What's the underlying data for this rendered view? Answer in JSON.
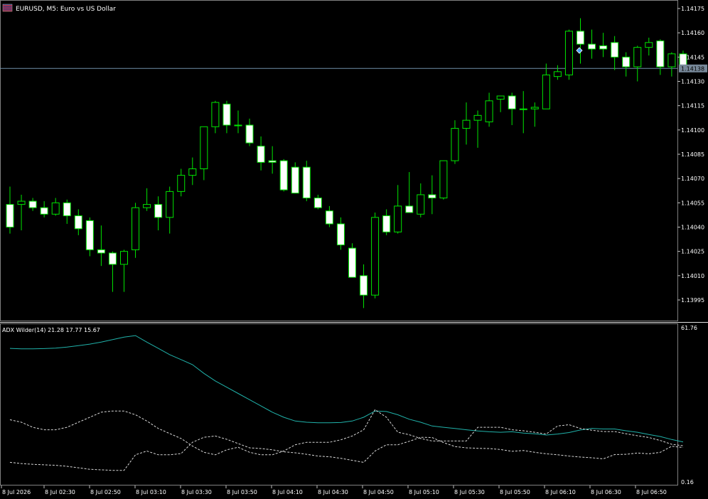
{
  "chart_data": [
    {
      "type": "candlestick",
      "title": "EURUSD, M5:  Euro vs US Dollar",
      "symbol_flag_icon": "flag-icon",
      "current_price": 1.14138,
      "current_price_label": "1.14138",
      "ylim": [
        1.1398,
        1.14183
      ],
      "y_ticks": [
        "1.14175",
        "1.14160",
        "1.14145",
        "1.14130",
        "1.14115",
        "1.14100",
        "1.14085",
        "1.14070",
        "1.14055",
        "1.14040",
        "1.14025",
        "1.14010",
        "1.13995"
      ],
      "x_ticks": [
        "8 Jul 2026",
        "8 Jul 02:30",
        "8 Jul 02:50",
        "8 Jul 03:10",
        "8 Jul 03:30",
        "8 Jul 03:50",
        "8 Jul 04:10",
        "8 Jul 04:30",
        "8 Jul 04:50",
        "8 Jul 05:10",
        "8 Jul 05:30",
        "8 Jul 05:50",
        "8 Jul 06:10",
        "8 Jul 06:30",
        "8 Jul 06:50"
      ],
      "candles": [
        {
          "o": 1.14054,
          "h": 1.14065,
          "l": 1.14036,
          "c": 1.1404
        },
        {
          "o": 1.14054,
          "h": 1.1406,
          "l": 1.14038,
          "c": 1.14056
        },
        {
          "o": 1.14056,
          "h": 1.14058,
          "l": 1.1405,
          "c": 1.14052
        },
        {
          "o": 1.14052,
          "h": 1.14056,
          "l": 1.14046,
          "c": 1.14048
        },
        {
          "o": 1.14048,
          "h": 1.14058,
          "l": 1.14047,
          "c": 1.14055
        },
        {
          "o": 1.14055,
          "h": 1.14057,
          "l": 1.14042,
          "c": 1.14047
        },
        {
          "o": 1.14047,
          "h": 1.14051,
          "l": 1.14035,
          "c": 1.14039
        },
        {
          "o": 1.14044,
          "h": 1.14046,
          "l": 1.14022,
          "c": 1.14026
        },
        {
          "o": 1.14026,
          "h": 1.14041,
          "l": 1.14016,
          "c": 1.14024
        },
        {
          "o": 1.14024,
          "h": 1.14025,
          "l": 1.14,
          "c": 1.14017
        },
        {
          "o": 1.14017,
          "h": 1.14026,
          "l": 1.14,
          "c": 1.14025
        },
        {
          "o": 1.14026,
          "h": 1.14055,
          "l": 1.14021,
          "c": 1.14052
        },
        {
          "o": 1.14052,
          "h": 1.14064,
          "l": 1.1405,
          "c": 1.14054
        },
        {
          "o": 1.14054,
          "h": 1.14059,
          "l": 1.14038,
          "c": 1.14046
        },
        {
          "o": 1.14046,
          "h": 1.14065,
          "l": 1.14036,
          "c": 1.14062
        },
        {
          "o": 1.14062,
          "h": 1.14076,
          "l": 1.14059,
          "c": 1.14072
        },
        {
          "o": 1.14072,
          "h": 1.14083,
          "l": 1.14066,
          "c": 1.14076
        },
        {
          "o": 1.14076,
          "h": 1.14102,
          "l": 1.14069,
          "c": 1.14102
        },
        {
          "o": 1.14102,
          "h": 1.14118,
          "l": 1.14098,
          "c": 1.14117
        },
        {
          "o": 1.14116,
          "h": 1.14118,
          "l": 1.14098,
          "c": 1.14103
        },
        {
          "o": 1.14103,
          "h": 1.14112,
          "l": 1.14098,
          "c": 1.14103
        },
        {
          "o": 1.14103,
          "h": 1.14107,
          "l": 1.1409,
          "c": 1.14092
        },
        {
          "o": 1.1409,
          "h": 1.14096,
          "l": 1.14075,
          "c": 1.1408
        },
        {
          "o": 1.14081,
          "h": 1.1409,
          "l": 1.14073,
          "c": 1.1408
        },
        {
          "o": 1.14081,
          "h": 1.14082,
          "l": 1.14062,
          "c": 1.14063
        },
        {
          "o": 1.14077,
          "h": 1.1408,
          "l": 1.14061,
          "c": 1.14061
        },
        {
          "o": 1.14077,
          "h": 1.14081,
          "l": 1.14056,
          "c": 1.14058
        },
        {
          "o": 1.14058,
          "h": 1.1406,
          "l": 1.14051,
          "c": 1.14052
        },
        {
          "o": 1.1405,
          "h": 1.14053,
          "l": 1.1404,
          "c": 1.14042
        },
        {
          "o": 1.14042,
          "h": 1.14046,
          "l": 1.14026,
          "c": 1.14029
        },
        {
          "o": 1.14027,
          "h": 1.1403,
          "l": 1.1401,
          "c": 1.14009
        },
        {
          "o": 1.1401,
          "h": 1.14017,
          "l": 1.1399,
          "c": 1.13998
        },
        {
          "o": 1.13998,
          "h": 1.14049,
          "l": 1.13996,
          "c": 1.14046
        },
        {
          "o": 1.14047,
          "h": 1.14051,
          "l": 1.14035,
          "c": 1.14037
        },
        {
          "o": 1.14037,
          "h": 1.14066,
          "l": 1.14036,
          "c": 1.14053
        },
        {
          "o": 1.14053,
          "h": 1.14074,
          "l": 1.14049,
          "c": 1.14049
        },
        {
          "o": 1.14048,
          "h": 1.14067,
          "l": 1.14046,
          "c": 1.1406
        },
        {
          "o": 1.1406,
          "h": 1.14072,
          "l": 1.14048,
          "c": 1.14058
        },
        {
          "o": 1.14058,
          "h": 1.14081,
          "l": 1.14057,
          "c": 1.14081
        },
        {
          "o": 1.14081,
          "h": 1.14106,
          "l": 1.14079,
          "c": 1.14101
        },
        {
          "o": 1.14101,
          "h": 1.14117,
          "l": 1.14091,
          "c": 1.14106
        },
        {
          "o": 1.14106,
          "h": 1.14112,
          "l": 1.14089,
          "c": 1.14109
        },
        {
          "o": 1.14105,
          "h": 1.14123,
          "l": 1.14102,
          "c": 1.14118
        },
        {
          "o": 1.14119,
          "h": 1.14121,
          "l": 1.14111,
          "c": 1.14121
        },
        {
          "o": 1.14121,
          "h": 1.14123,
          "l": 1.14103,
          "c": 1.14113
        },
        {
          "o": 1.14113,
          "h": 1.14124,
          "l": 1.14098,
          "c": 1.14113
        },
        {
          "o": 1.14113,
          "h": 1.14117,
          "l": 1.14102,
          "c": 1.14114
        },
        {
          "o": 1.14113,
          "h": 1.14141,
          "l": 1.14113,
          "c": 1.14134
        },
        {
          "o": 1.14133,
          "h": 1.1414,
          "l": 1.14131,
          "c": 1.14136
        },
        {
          "o": 1.14134,
          "h": 1.14162,
          "l": 1.14131,
          "c": 1.14161
        },
        {
          "o": 1.14161,
          "h": 1.14169,
          "l": 1.14141,
          "c": 1.14153
        },
        {
          "o": 1.14153,
          "h": 1.14162,
          "l": 1.14144,
          "c": 1.1415
        },
        {
          "o": 1.14152,
          "h": 1.1416,
          "l": 1.14145,
          "c": 1.1415
        },
        {
          "o": 1.14154,
          "h": 1.14158,
          "l": 1.14137,
          "c": 1.14145
        },
        {
          "o": 1.14145,
          "h": 1.14148,
          "l": 1.14133,
          "c": 1.14139
        },
        {
          "o": 1.14139,
          "h": 1.14152,
          "l": 1.1413,
          "c": 1.14151
        },
        {
          "o": 1.14151,
          "h": 1.14157,
          "l": 1.14146,
          "c": 1.14154
        },
        {
          "o": 1.14155,
          "h": 1.14156,
          "l": 1.14134,
          "c": 1.14139
        },
        {
          "o": 1.14139,
          "h": 1.14148,
          "l": 1.14133,
          "c": 1.14147
        },
        {
          "o": 1.14147,
          "h": 1.14149,
          "l": 1.14136,
          "c": 1.14139
        }
      ]
    },
    {
      "type": "line",
      "indicator_label": "ADX Wilder(14) 21.28 17.77 15.67",
      "ylim": [
        0.16,
        61.76
      ],
      "y_ticks": [
        "61.76",
        "0.16"
      ],
      "series": [
        {
          "style": "solid",
          "color": "#20b2aa",
          "values": [
            53.5,
            53.3,
            53.3,
            53.4,
            53.6,
            54,
            54.6,
            55.2,
            56,
            57,
            58,
            58.6,
            56,
            53.5,
            51,
            49,
            47,
            43.5,
            40.5,
            38,
            35.5,
            33,
            30.5,
            28,
            26,
            24.5,
            24,
            23.8,
            23.8,
            23.9,
            24.5,
            26,
            28.5,
            28.3,
            27,
            25.2,
            24,
            22.5,
            22,
            21.5,
            21,
            20.5,
            20.2,
            20,
            20.2,
            19.7,
            19.4,
            18.9,
            19.3,
            19.9,
            20.9,
            21.5,
            21.3,
            21.3,
            20.6,
            20,
            19.1,
            18.3,
            17.1,
            16.1
          ]
        },
        {
          "style": "dashed",
          "color": "#d8d8d8",
          "values": [
            25,
            24,
            22,
            21,
            21,
            22,
            24,
            26,
            28,
            28.5,
            28.5,
            27,
            24.5,
            21.5,
            19.5,
            17.5,
            14.5,
            12,
            11,
            13,
            14,
            12,
            11,
            11,
            12.5,
            15,
            16,
            16,
            16,
            17,
            18.5,
            21,
            29,
            26,
            20,
            19,
            17.5,
            16.5,
            16.5,
            16.5,
            16.5,
            22,
            22,
            22,
            21,
            20.6,
            20,
            19.3,
            22.5,
            23,
            21.5,
            20.8,
            20.3,
            20.3,
            19.4,
            18.6,
            17.9,
            16.7,
            15.2,
            14.6
          ]
        },
        {
          "style": "dashed",
          "color": "#d8d8d8",
          "values": [
            8,
            7.5,
            7.2,
            7,
            6.8,
            6.4,
            5.8,
            5.2,
            5,
            4.8,
            4.8,
            11,
            12.5,
            11,
            11,
            11.5,
            16,
            18,
            18.5,
            17.2,
            15.5,
            13.8,
            13.5,
            13,
            12.2,
            11.8,
            11.2,
            10.5,
            10.2,
            9.6,
            8.8,
            8,
            12.5,
            15,
            15,
            16.4,
            18,
            17.9,
            15.9,
            14.3,
            13.8,
            13.6,
            13.5,
            13.1,
            12.4,
            12.7,
            12,
            11.4,
            11,
            10.5,
            10.1,
            9.8,
            9.4,
            11.1,
            11.2,
            11.7,
            11.4,
            12,
            14.4,
            13.9
          ]
        }
      ]
    }
  ]
}
